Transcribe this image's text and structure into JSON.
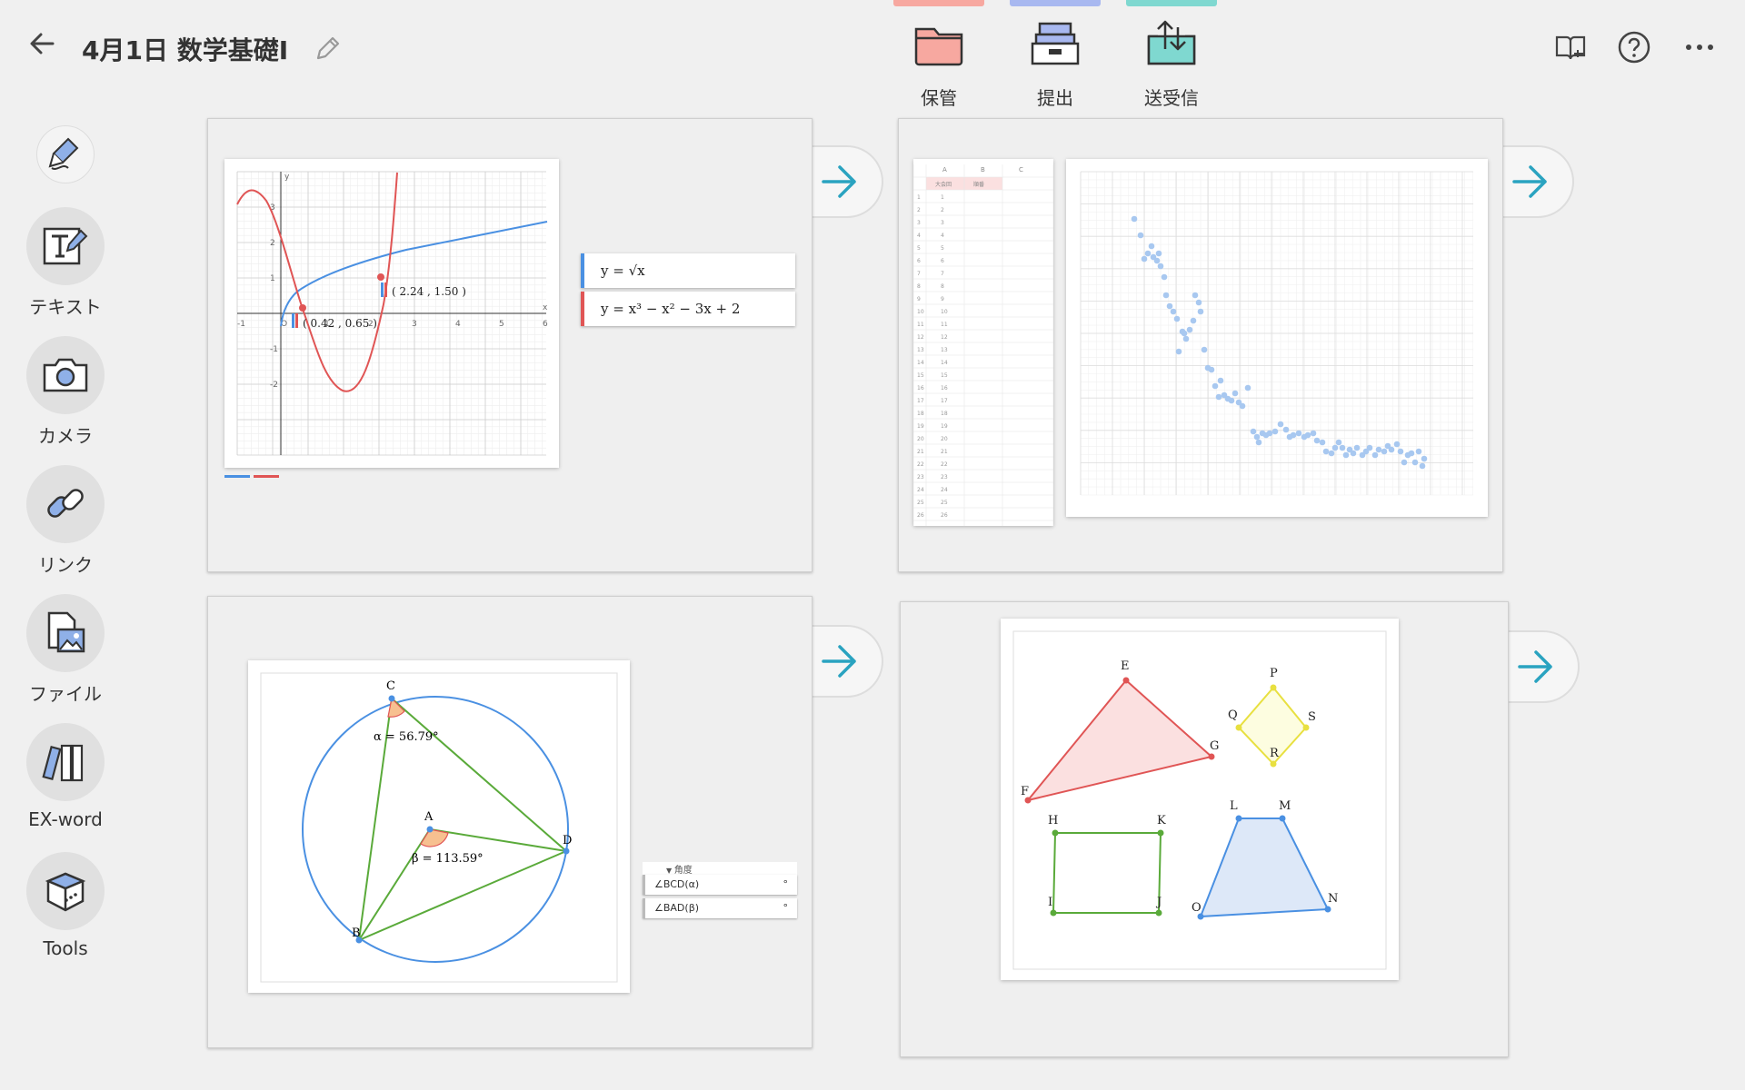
{
  "header": {
    "title": "4月1日 数学基礎I"
  },
  "toolbar": {
    "buttons": [
      {
        "label": "保管",
        "strip_color": "#f7a8a0"
      },
      {
        "label": "提出",
        "strip_color": "#a8b8f0"
      },
      {
        "label": "送受信",
        "strip_color": "#7fd8d0"
      }
    ]
  },
  "sidebar": {
    "items": [
      {
        "label": "",
        "icon": "pen-icon"
      },
      {
        "label": "テキスト",
        "icon": "text-icon"
      },
      {
        "label": "カメラ",
        "icon": "camera-icon"
      },
      {
        "label": "リンク",
        "icon": "link-icon"
      },
      {
        "label": "ファイル",
        "icon": "file-image-icon"
      },
      {
        "label": "EX-word",
        "icon": "dictionary-icon"
      },
      {
        "label": "Tools",
        "icon": "toolbox-icon"
      }
    ]
  },
  "cards": {
    "graph": {
      "point1": "( 0.42 , 0.65 )",
      "point2": "( 2.24 , 1.50 )",
      "eq1": "y = √x",
      "eq2": "y = x³ − x² − 3x + 2",
      "y_ticks": [
        "3",
        "2",
        "1",
        "-1",
        "-2"
      ],
      "x_ticks": [
        "-1",
        "O",
        "1",
        "2",
        "3",
        "4",
        "5",
        "6"
      ],
      "axis_x": "x",
      "axis_y": "y"
    },
    "scatter": {
      "table_headers": [
        "A",
        "B",
        "C"
      ],
      "table_subheaders": [
        "大会回",
        "順番"
      ],
      "rows": 26
    },
    "circle": {
      "label_c": "C",
      "label_a": "A",
      "label_b": "B",
      "label_d": "D",
      "alpha": "α = 56.79°",
      "beta": "β = 113.59°",
      "legend_header": "角度",
      "legend_item1": "∠BCD(α)",
      "legend_item2": "∠BAD(β)",
      "legend_unit": "°"
    },
    "shapes": {
      "labels": [
        "E",
        "F",
        "G",
        "P",
        "Q",
        "R",
        "S",
        "H",
        "K",
        "I",
        "J",
        "L",
        "M",
        "N",
        "O"
      ]
    }
  },
  "colors": {
    "blue": "#4a90e2",
    "red": "#e05555",
    "green": "#5aaa3a",
    "yellow": "#e8e040",
    "teal": "#2aa3c0"
  }
}
